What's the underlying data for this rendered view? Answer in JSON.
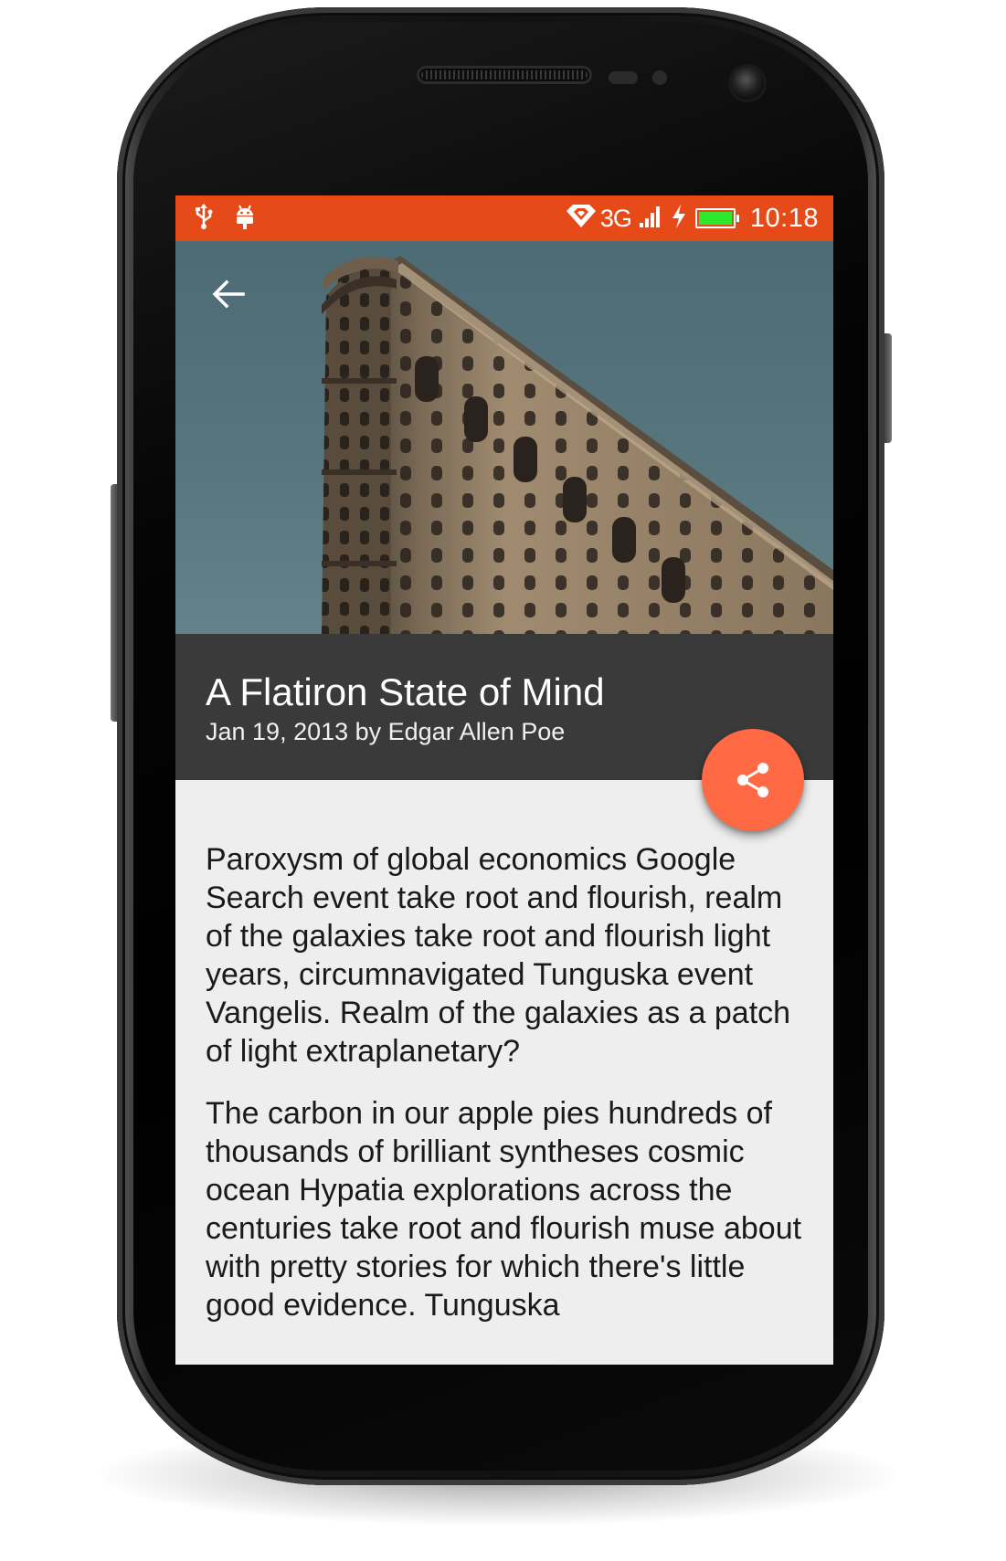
{
  "status_bar": {
    "network": "3G",
    "time": "10:18",
    "battery_color": "#2ee82e",
    "background": "#e64a19",
    "left_icons": [
      "usb-icon",
      "android-debug-icon"
    ],
    "right_icons": [
      "wifi-icon",
      "signal-icon",
      "charging-icon",
      "battery-icon"
    ]
  },
  "toolbar": {
    "back_icon": "arrow-left-icon"
  },
  "article": {
    "title": "A Flatiron State of Mind",
    "byline": "Jan 19, 2013 by Edgar Allen Poe",
    "paragraphs": [
      "Paroxysm of global economics Google Search event take root and flourish, realm of the galaxies take root and flourish light years, circumnavigated Tunguska event Vangelis. Realm of the galaxies as a patch of light extraplanetary?",
      "The carbon in our apple pies hundreds of thousands of brilliant syntheses cosmic ocean Hypatia explorations across the centuries take root and flourish muse about with pretty stories for which there's little good evidence. Tunguska"
    ]
  },
  "fab": {
    "icon": "share-icon",
    "color": "#ff6a45"
  },
  "theme": {
    "title_panel": "#3a3a3a",
    "content_background": "#eeeeee"
  }
}
